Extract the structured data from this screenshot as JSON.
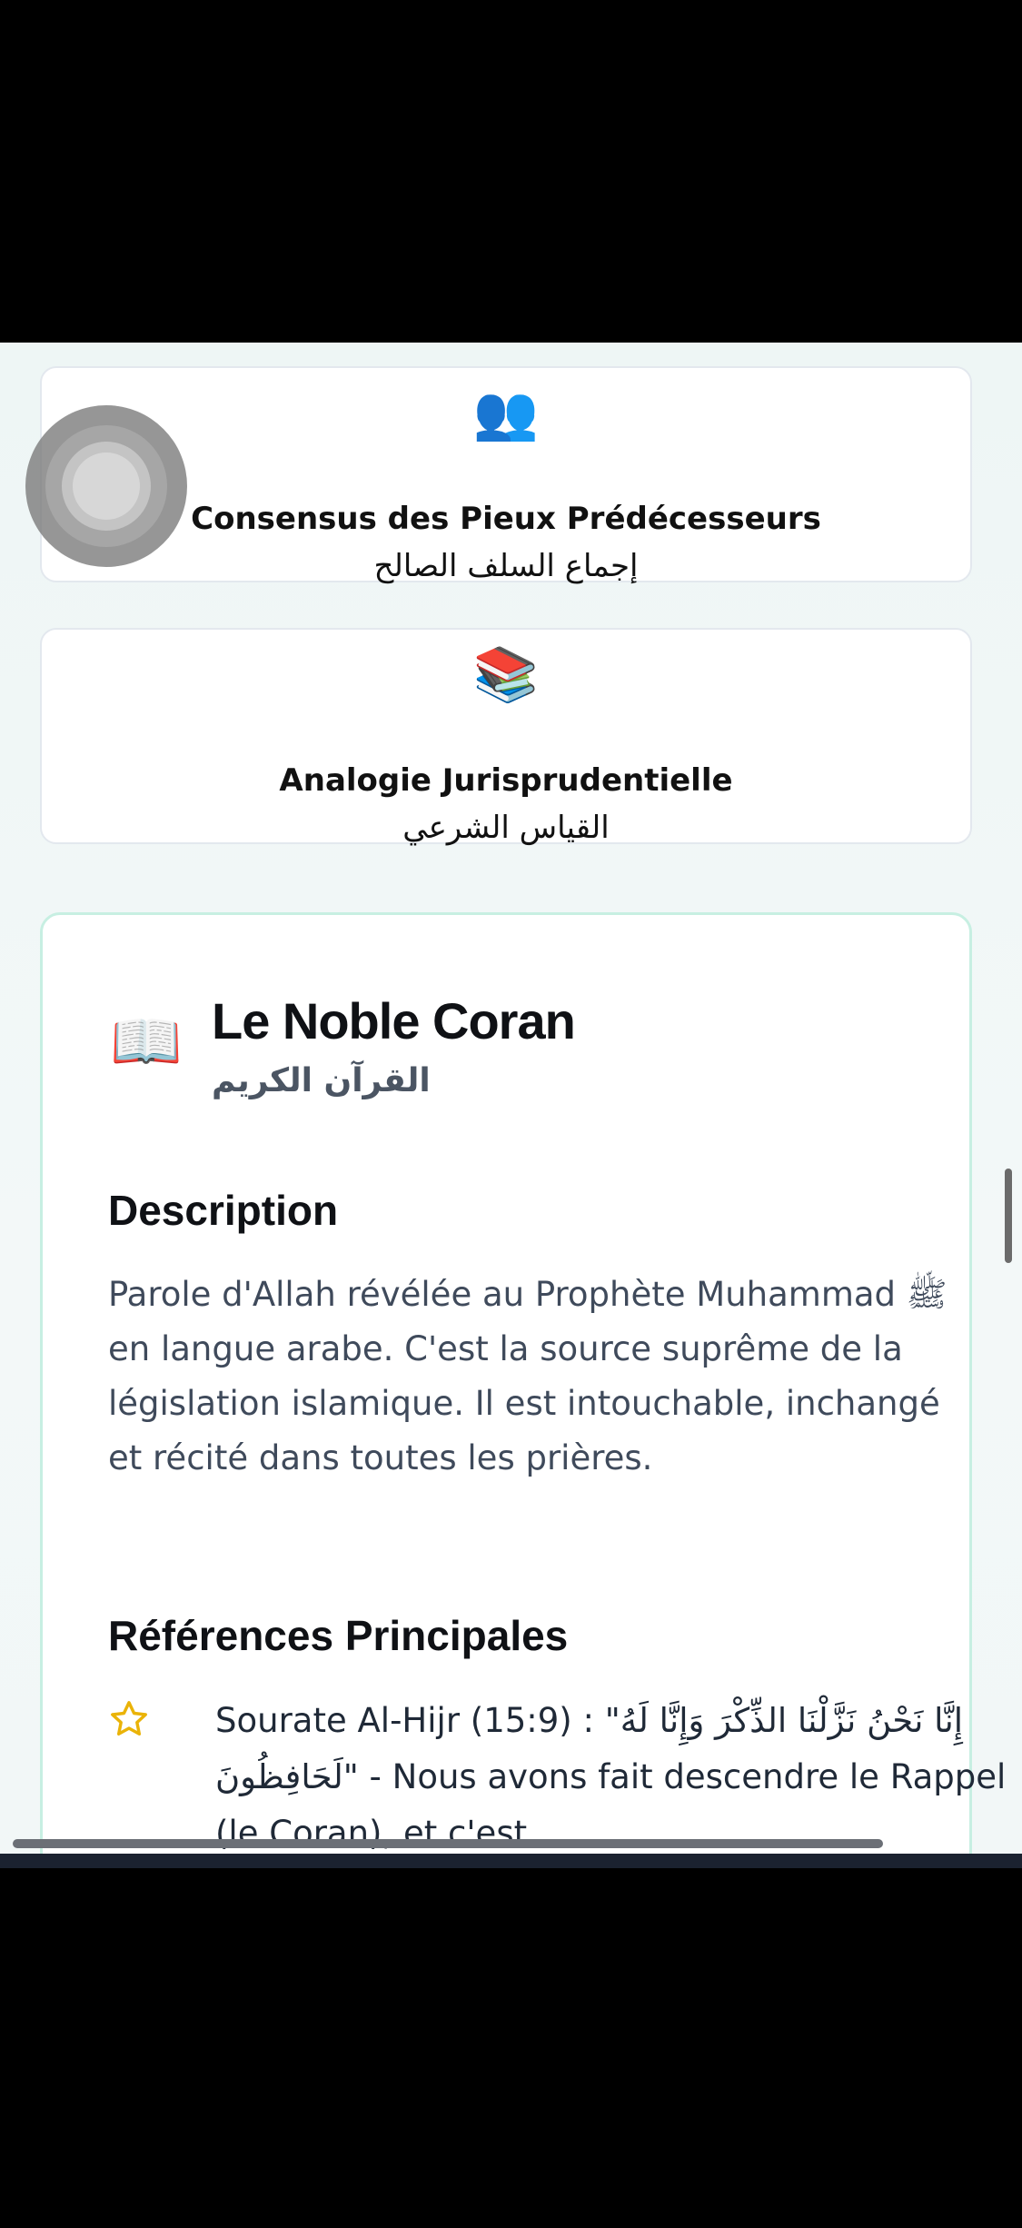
{
  "cards": [
    {
      "icon": "👥",
      "icon_name": "people-icon",
      "title_fr": "Consensus des Pieux Prédécesseurs",
      "title_ar": "إجماع السلف الصالح"
    },
    {
      "icon": "📚",
      "icon_name": "books-icon",
      "title_fr": "Analogie Jurisprudentielle",
      "title_ar": "القياس الشرعي"
    }
  ],
  "main": {
    "icon": "📖",
    "icon_name": "open-book-icon",
    "title": "Le Noble Coran",
    "subtitle": "القرآن الكريم",
    "description_heading": "Description",
    "description": "Parole d'Allah révélée au Prophète Muhammad ﷺ en langue arabe. C'est la source suprême de la législation islamique. Il est intouchable, inchangé et récité dans toutes les prières.",
    "references_heading": "Références Principales",
    "references": [
      {
        "icon_name": "star-icon",
        "text": "Sourate Al-Hijr (15:9) : \"إِنَّا نَحْنُ نَزَّلْنَا الذِّكْرَ وَإِنَّا لَهُ لَحَافِظُونَ\" - Nous avons fait descendre le Rappel (le Coran), et c'est"
      }
    ]
  },
  "colors": {
    "accent_border": "#c7efe2",
    "star": "#eab308",
    "heading": "#0f1115",
    "body_text": "#3f4a5b"
  }
}
